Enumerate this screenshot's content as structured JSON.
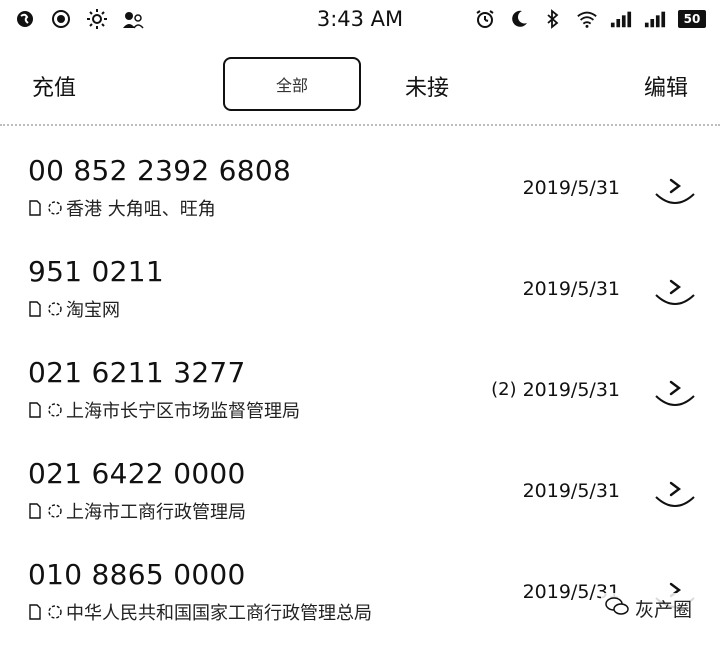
{
  "status_bar": {
    "time": "3:43 AM",
    "battery": "50"
  },
  "tabs": {
    "recharge": "充值",
    "all": "全部",
    "missed": "未接",
    "edit": "编辑"
  },
  "calls": [
    {
      "number": "00 852 2392 6808",
      "location": "香港 大角咀、旺角",
      "count": "",
      "date": "2019/5/31"
    },
    {
      "number": "951 0211",
      "location": "淘宝网",
      "count": "",
      "date": "2019/5/31"
    },
    {
      "number": "021 6211 3277",
      "location": "上海市长宁区市场监督管理局",
      "count": "(2)",
      "date": "2019/5/31"
    },
    {
      "number": "021 6422 0000",
      "location": "上海市工商行政管理局",
      "count": "",
      "date": "2019/5/31"
    },
    {
      "number": "010 8865 0000",
      "location": "中华人民共和国国家工商行政管理总局",
      "count": "",
      "date": "2019/5/31"
    }
  ],
  "watermark": "灰产圈"
}
